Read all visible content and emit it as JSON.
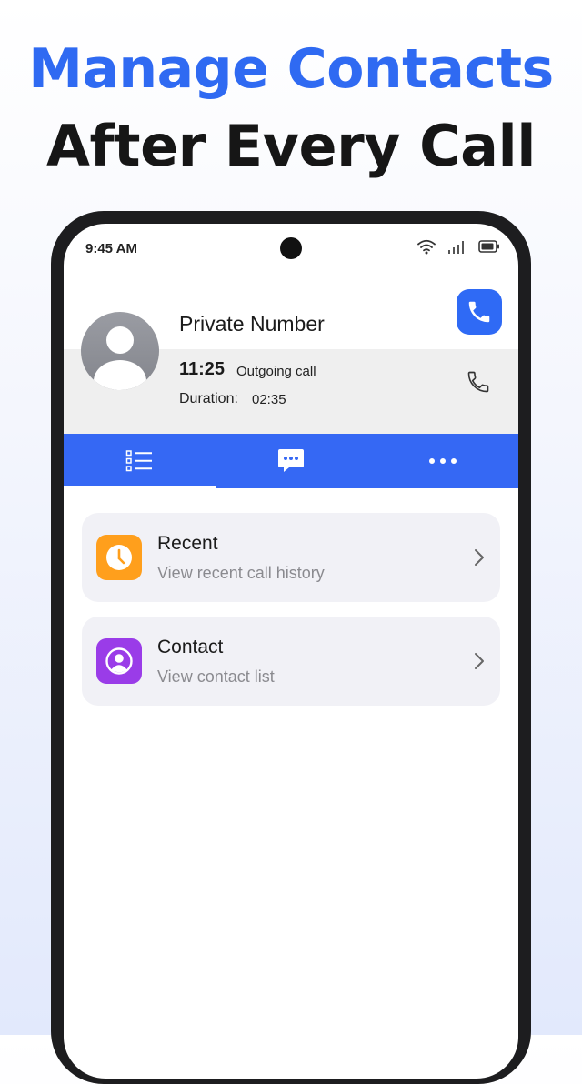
{
  "headline": {
    "line1": "Manage Contacts",
    "line2": "After Every Call",
    "line1_color": "#2f6af2",
    "line2_color": "#161616"
  },
  "status_bar": {
    "time": "9:45 AM",
    "icons": [
      "wifi-icon",
      "signal-icon",
      "battery-icon"
    ]
  },
  "call": {
    "name": "Private Number",
    "time": "11:25",
    "type": "Outgoing call",
    "duration_label": "Duration:",
    "duration_value": "02:35",
    "icons": [
      "avatar-person-icon",
      "phone-button-icon",
      "phone-outline-icon"
    ]
  },
  "tabs": [
    {
      "icon": "list-icon",
      "selected": true
    },
    {
      "icon": "message-icon",
      "selected": false
    },
    {
      "icon": "more-icon",
      "selected": false
    }
  ],
  "menu": [
    {
      "title": "Recent",
      "subtitle": "View recent call history",
      "icon": "clock-icon",
      "icon_color": "#ff9f1c"
    },
    {
      "title": "Contact",
      "subtitle": "View contact list",
      "icon": "contact-icon",
      "icon_color": "#9a3ce8"
    }
  ],
  "colors": {
    "accent": "#3568f4",
    "card_bg": "#f1f1f6"
  }
}
